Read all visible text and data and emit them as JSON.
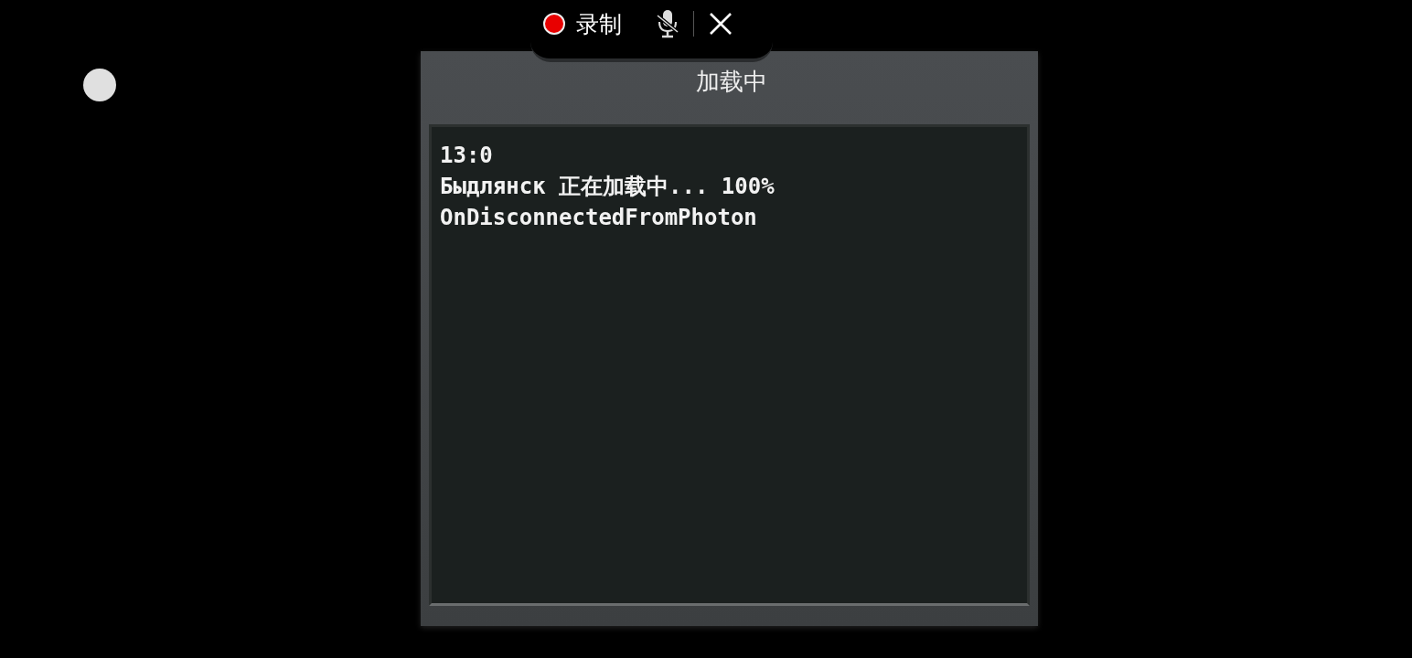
{
  "recorder_bar": {
    "label": "录制",
    "recording": true
  },
  "dialog": {
    "title": "加载中",
    "log_lines": [
      "13:0",
      "Быдлянск 正在加载中... 100%",
      "OnDisconnectedFromPhoton"
    ]
  }
}
